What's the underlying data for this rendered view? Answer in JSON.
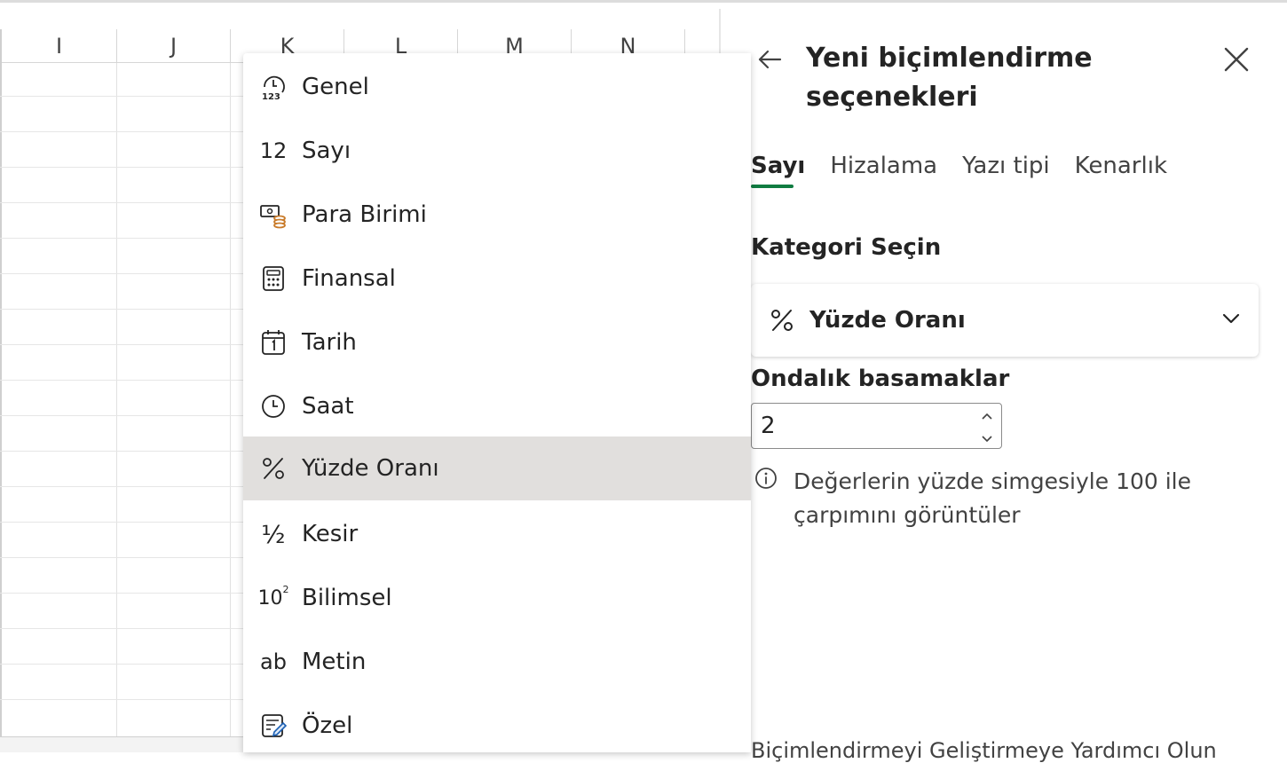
{
  "sheet": {
    "columns": [
      "I",
      "J",
      "K",
      "L",
      "M",
      "N"
    ]
  },
  "dropdown": {
    "items": [
      {
        "label": "Genel",
        "icon": "general-format-icon"
      },
      {
        "label": "Sayı",
        "icon": "number-format-icon"
      },
      {
        "label": "Para Birimi",
        "icon": "currency-icon"
      },
      {
        "label": "Finansal",
        "icon": "calculator-icon"
      },
      {
        "label": "Tarih",
        "icon": "calendar-icon"
      },
      {
        "label": "Saat",
        "icon": "clock-icon"
      },
      {
        "label": "Yüzde Oranı",
        "icon": "percent-icon",
        "selected": true
      },
      {
        "label": "Kesir",
        "icon": "fraction-icon"
      },
      {
        "label": "Bilimsel",
        "icon": "scientific-icon"
      },
      {
        "label": "Metin",
        "icon": "text-format-icon"
      },
      {
        "label": "Özel",
        "icon": "custom-format-icon"
      }
    ],
    "number_icon_text": "12",
    "fraction_icon_text": "½",
    "scientific_icon_base": "10",
    "scientific_icon_exp": "2",
    "text_icon_text": "ab",
    "general_icon_text": "123"
  },
  "panel": {
    "title": "Yeni biçimlendirme seçenekleri",
    "tabs": [
      {
        "label": "Sayı",
        "active": true
      },
      {
        "label": "Hizalama"
      },
      {
        "label": "Yazı tipi"
      },
      {
        "label": "Kenarlık"
      }
    ],
    "category_label": "Kategori Seçin",
    "category_value": "Yüzde Oranı",
    "decimal_label": "Ondalık basamaklar",
    "decimal_value": "2",
    "info_text": "Değerlerin yüzde simgesiyle 100 ile çarpımını görüntüler",
    "footer_text": "Biçimlendirmeyi Geliştirmeye Yardımcı Olun"
  },
  "colors": {
    "accent": "#107c41",
    "selected_bg": "#e1dfdd",
    "currency_coin": "#c97b2a"
  }
}
